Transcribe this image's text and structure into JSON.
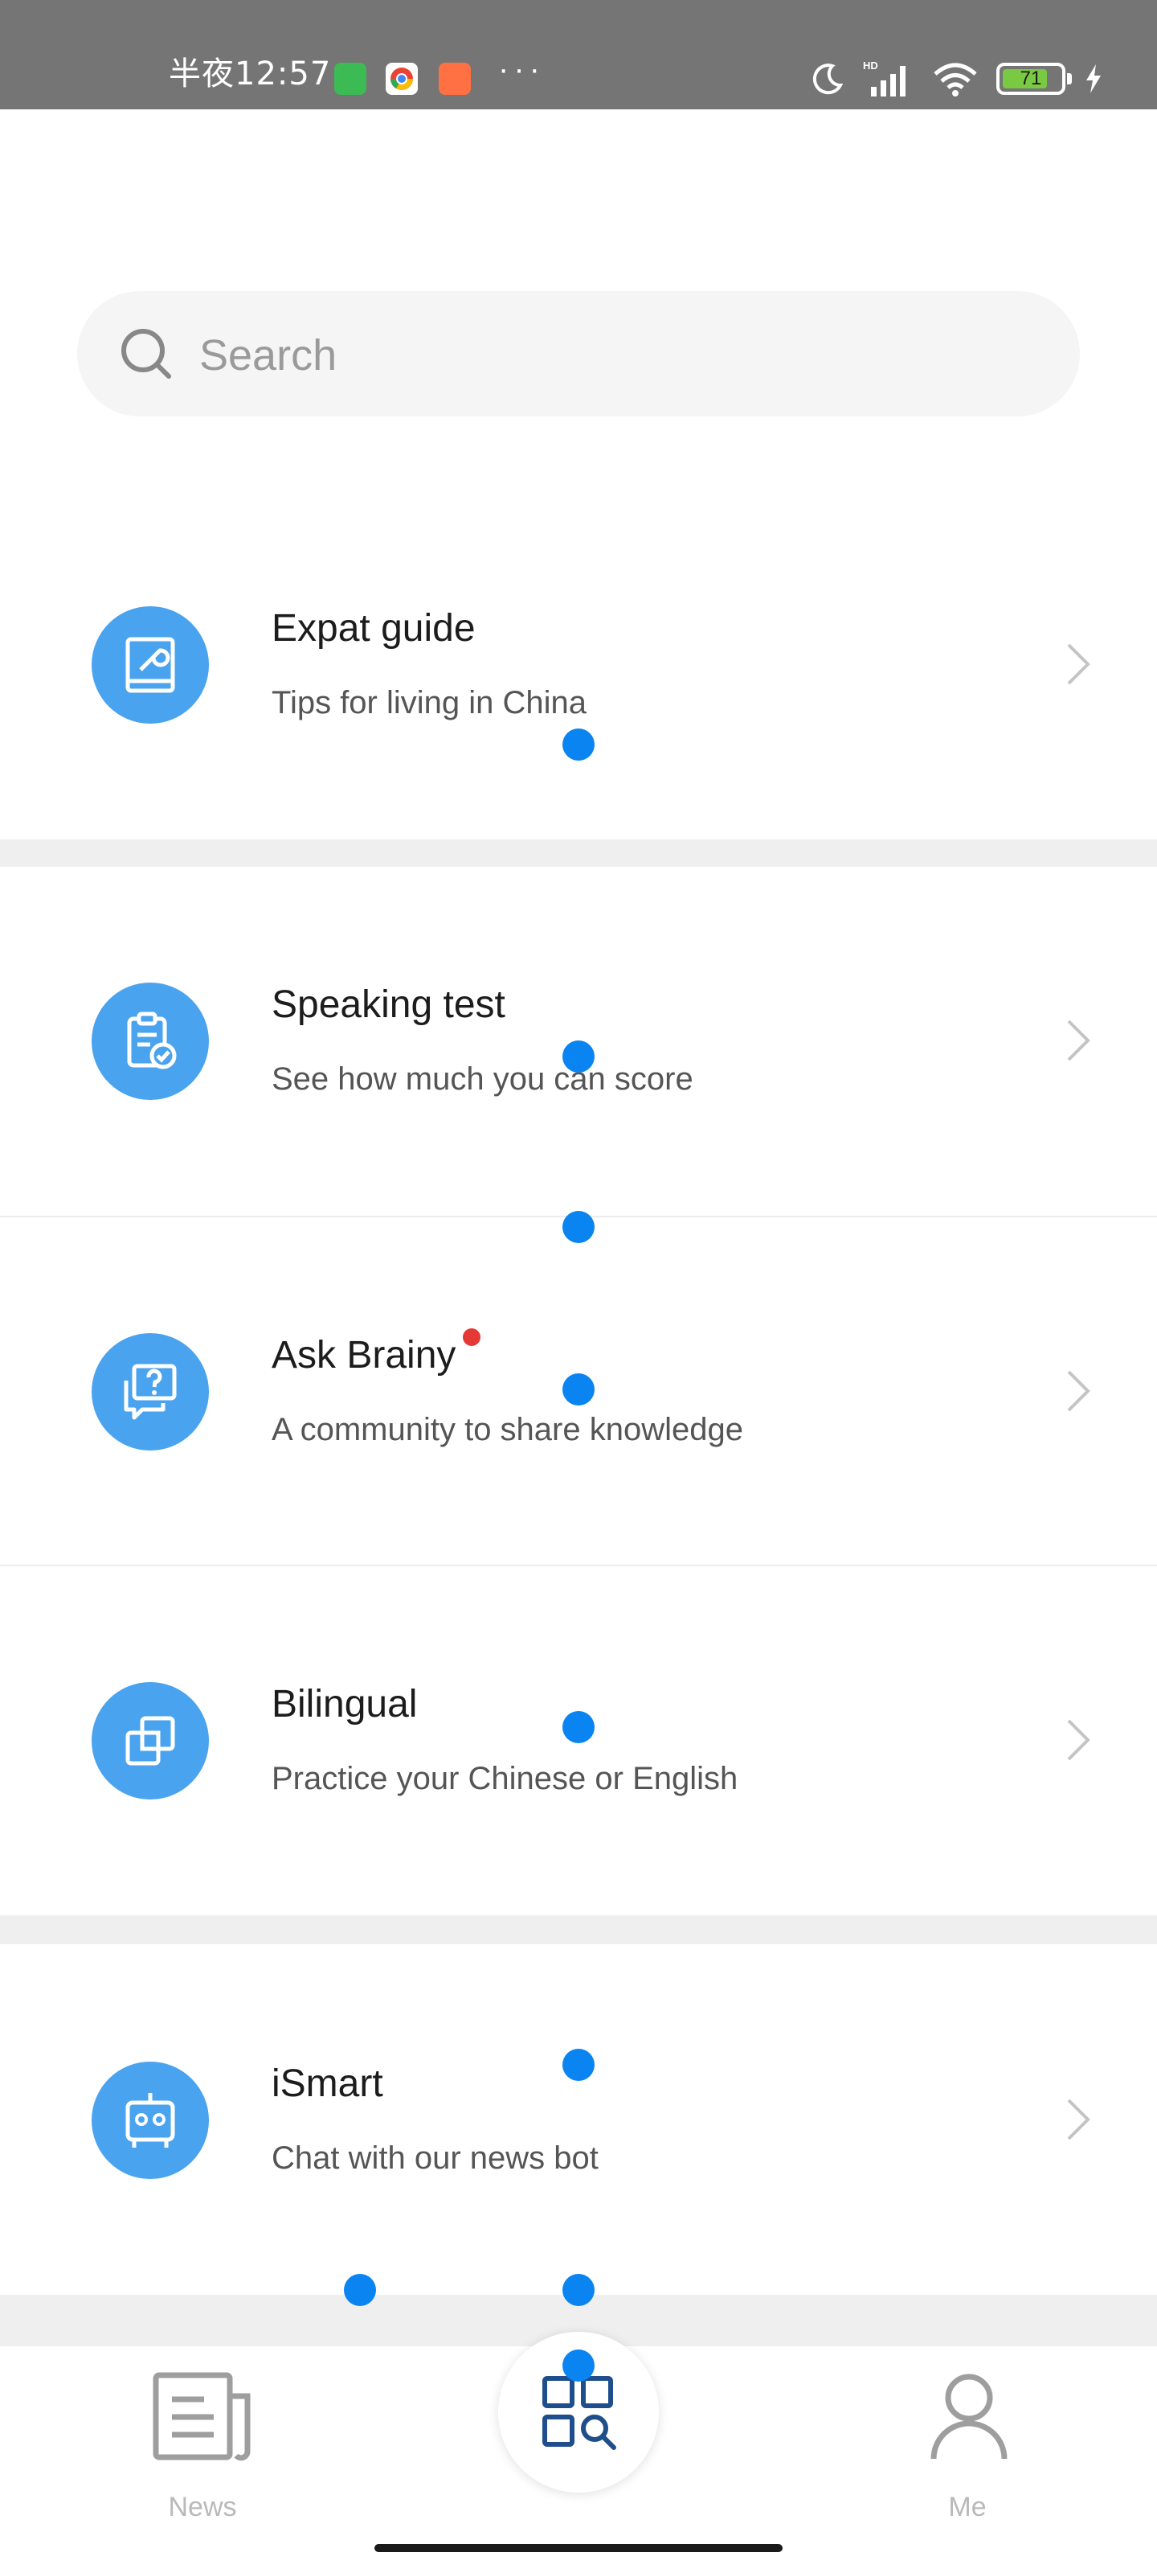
{
  "status_bar": {
    "time": "半夜12:57",
    "more": "···",
    "battery_level": "71",
    "colors": {
      "app1": "#3cba54",
      "app3": "#ff7043"
    }
  },
  "search": {
    "placeholder": "Search",
    "icon": "search-icon"
  },
  "list": [
    {
      "title": "Expat guide",
      "subtitle": "Tips for living in China",
      "icon": "book-wrench-icon"
    },
    {
      "title": "Speaking test",
      "subtitle": "See how much you can score",
      "icon": "clipboard-check-icon"
    },
    {
      "title": "Ask Brainy",
      "subtitle": "A community to share knowledge",
      "icon": "question-chat-icon",
      "has_notification": true
    },
    {
      "title": "Bilingual",
      "subtitle": "Practice your Chinese or English",
      "icon": "overlap-squares-icon"
    },
    {
      "title": "iSmart",
      "subtitle": "Chat with our news bot",
      "icon": "robot-icon"
    }
  ],
  "bottom_nav": {
    "items": [
      {
        "label": "News",
        "icon": "newspaper-icon"
      },
      {
        "label": "",
        "icon": "discover-grid-icon",
        "active": true
      },
      {
        "label": "Me",
        "icon": "person-icon",
        "has_notification": true
      }
    ]
  },
  "colors": {
    "accent": "#4aa3ee",
    "nav_active": "#1f4e8c",
    "notification": "#e53935",
    "touch_marker": "#0a84f0"
  }
}
